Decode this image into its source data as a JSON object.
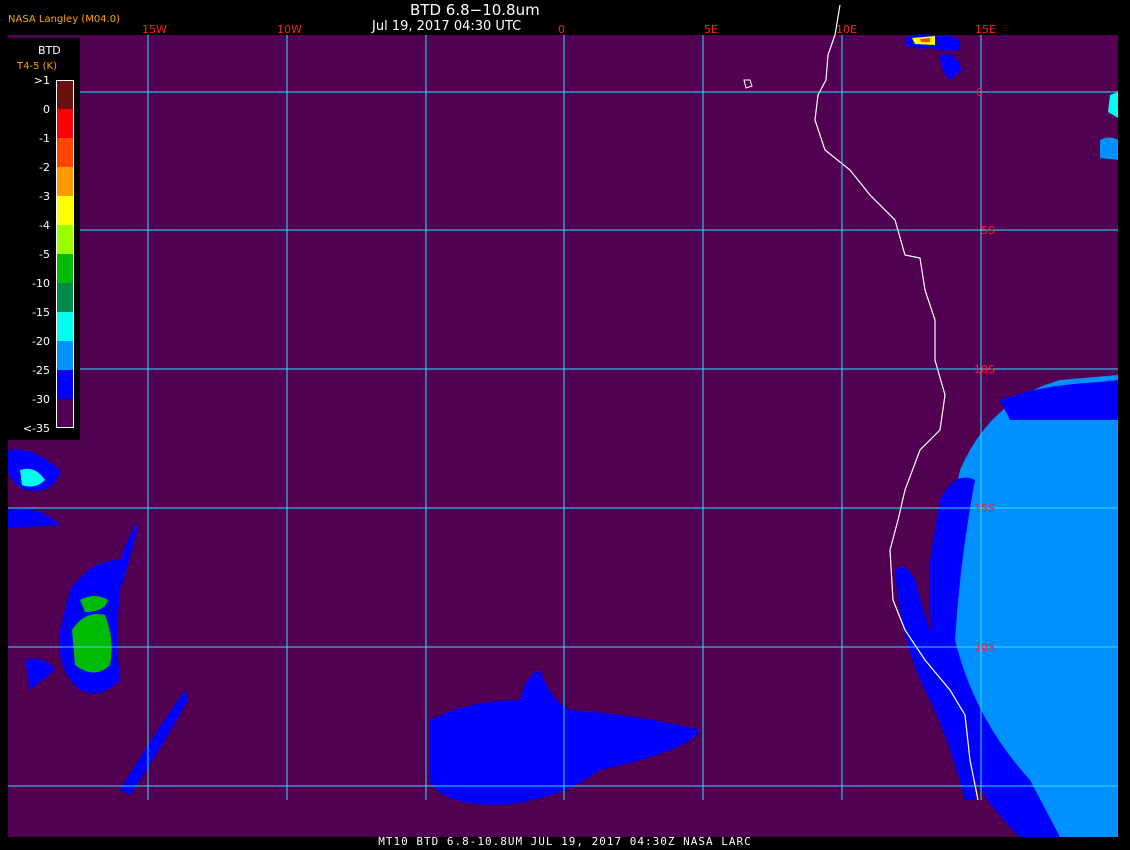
{
  "header": {
    "credit": "NASA Langley (M04.0)",
    "title": "BTD 6.8−10.8um",
    "subtitle": "Jul 19, 2017 04:30 UTC"
  },
  "footer": {
    "caption": "MT10  BTD 6.8-10.8UM  JUL 19, 2017 04:30Z  NASA LARC"
  },
  "legend": {
    "title": "BTD",
    "subtitle": "T4-5 (K)",
    "entries": [
      {
        "label": ">1",
        "color": "#6b0f0f"
      },
      {
        "label": "0",
        "color": "#ff0000"
      },
      {
        "label": "-1",
        "color": "#ff4500"
      },
      {
        "label": "-2",
        "color": "#ff9900"
      },
      {
        "label": "-3",
        "color": "#ffff00"
      },
      {
        "label": "-4",
        "color": "#99ff00"
      },
      {
        "label": "-5",
        "color": "#00bb00"
      },
      {
        "label": "-10",
        "color": "#008a4a"
      },
      {
        "label": "-15",
        "color": "#00ffee"
      },
      {
        "label": "-20",
        "color": "#0090ff"
      },
      {
        "label": "-25",
        "color": "#0000ff"
      },
      {
        "label": "-30",
        "color": "#520052"
      },
      {
        "label": "<-35",
        "color": ""
      }
    ]
  },
  "map": {
    "background_color": "#520052",
    "grid_color": "#33ddff",
    "coast_color": "#ffffff",
    "lon_labels": [
      "15W",
      "10W",
      "0",
      "5E",
      "10E",
      "15E"
    ],
    "lat_labels": [
      "0",
      "5S",
      "10S",
      "15S",
      "20S"
    ],
    "label_color": "#ff2020"
  }
}
